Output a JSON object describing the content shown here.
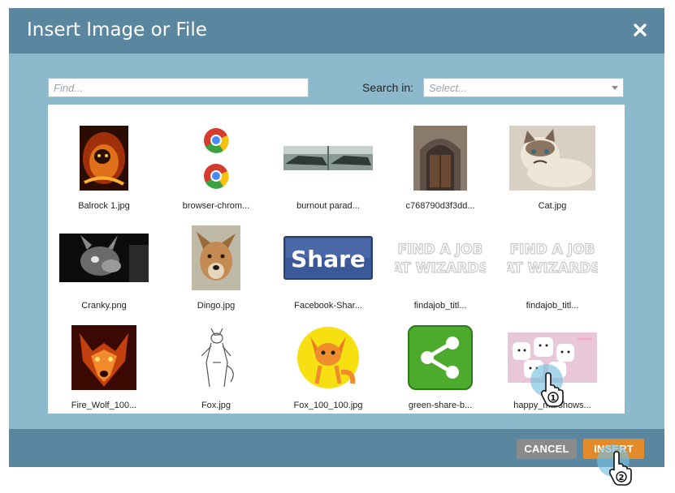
{
  "dialog": {
    "title": "Insert Image or File",
    "close_icon": "close-icon"
  },
  "search": {
    "find_placeholder": "Find...",
    "search_in_label": "Search in:",
    "select_placeholder": "Select..."
  },
  "files": [
    {
      "name": "Balrock 1.jpg"
    },
    {
      "name": "browser-chrom..."
    },
    {
      "name": "burnout parad..."
    },
    {
      "name": "c768790d3f3dd..."
    },
    {
      "name": "Cat.jpg"
    },
    {
      "name": "Cranky.png"
    },
    {
      "name": "Dingo.jpg"
    },
    {
      "name": "Facebook-Shar...",
      "thumb_text": "Share"
    },
    {
      "name": "findajob_titl...",
      "thumb_text_1": "FIND A JOB",
      "thumb_text_2": "AT WIZARDS"
    },
    {
      "name": "findajob_titl...",
      "thumb_text_1": "FIND A JOB",
      "thumb_text_2": "AT WIZARDS"
    },
    {
      "name": "Fire_Wolf_100..."
    },
    {
      "name": "Fox.jpg"
    },
    {
      "name": "Fox_100_100.jpg"
    },
    {
      "name": "green-share-b..."
    },
    {
      "name": "happy_marshows..."
    }
  ],
  "footer": {
    "cancel_label": "CANCEL",
    "insert_label": "INSERT"
  },
  "annotations": {
    "step1": "1",
    "step2": "2"
  },
  "colors": {
    "titlebar": "#5b86a0",
    "body": "#8db9cc",
    "insert_button": "#e38a2a",
    "cancel_button": "#8a8a8a"
  }
}
